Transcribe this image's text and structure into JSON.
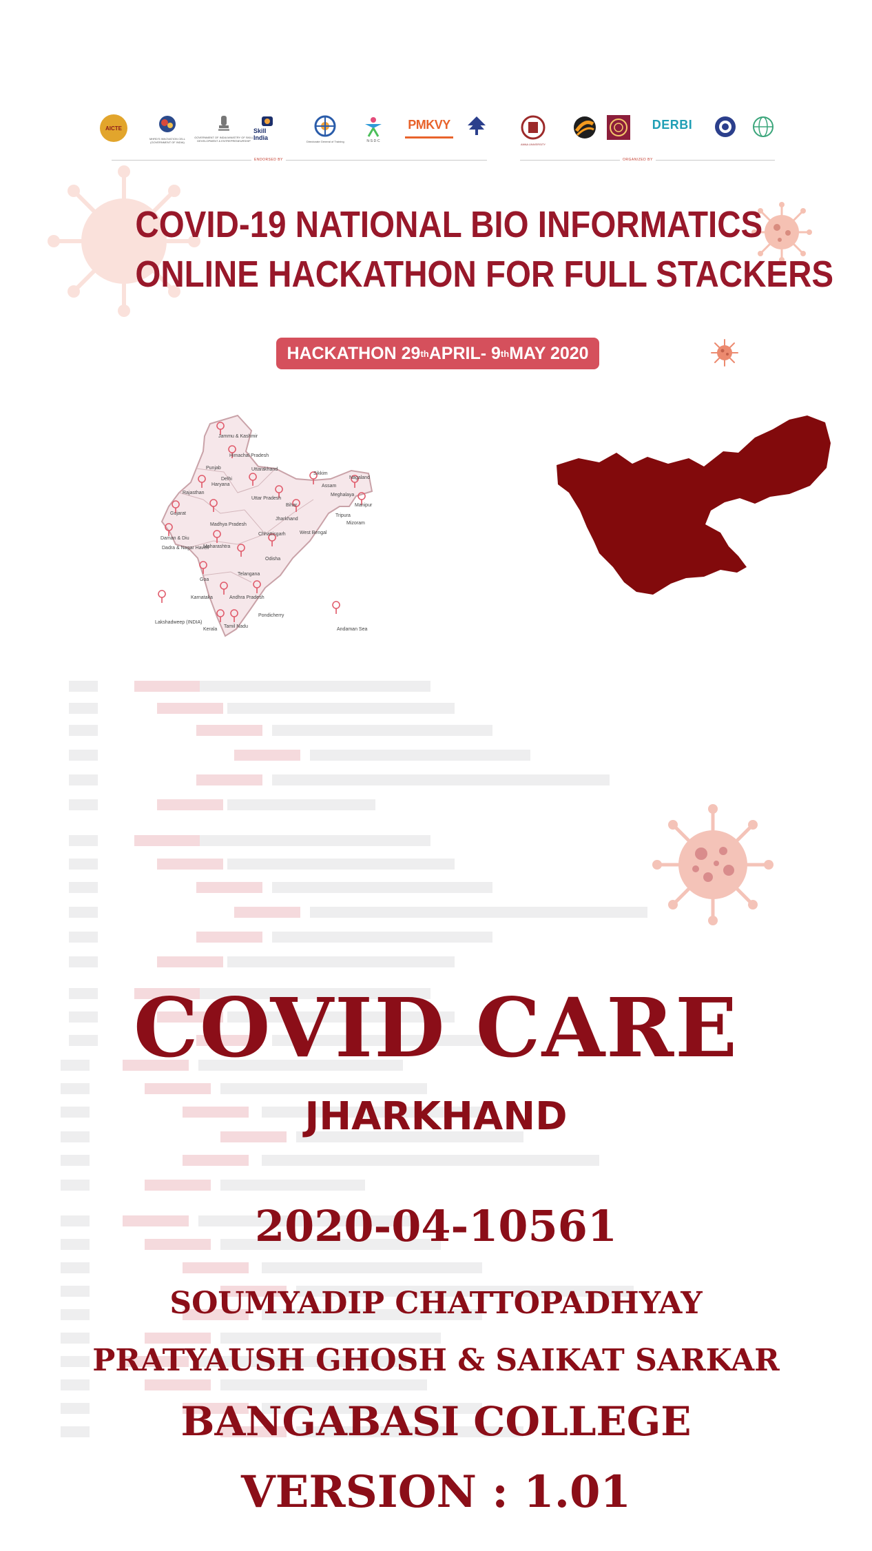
{
  "endorsed_by_label": "ENDORSED BY",
  "organized_by_label": "ORGANIZED BY",
  "endorsed_logos": [
    {
      "name": "aicte-logo",
      "caption": "",
      "text": "AICTE"
    },
    {
      "name": "innovation-cell-logo",
      "caption": "MHRD'S INNOVATION CELL (GOVERNMENT OF INDIA)",
      "text": ""
    },
    {
      "name": "msde-logo",
      "caption": "GOVERNMENT OF INDIA MINISTRY OF SKILL DEVELOPMENT & ENTREPRENEURSHIP",
      "text": ""
    },
    {
      "name": "skill-india-logo",
      "caption": "",
      "text": "Skill India"
    },
    {
      "name": "dgt-logo",
      "caption": "Directorate General of Training",
      "text": ""
    },
    {
      "name": "nsdc-logo",
      "caption": "N·S·D·C",
      "text": ""
    },
    {
      "name": "pmkvy-logo",
      "caption": "",
      "text": "PMKVY"
    },
    {
      "name": "emblem-logo",
      "caption": "",
      "text": ""
    }
  ],
  "organizer_logos": [
    {
      "name": "anna-university-logo",
      "caption": "ANNA UNIVERSITY",
      "text": ""
    },
    {
      "name": "organizer-logo-2",
      "caption": "",
      "text": ""
    },
    {
      "name": "organizer-logo-3",
      "caption": "",
      "text": ""
    },
    {
      "name": "derbi-logo",
      "caption": "",
      "text": "DERBI"
    },
    {
      "name": "organizer-logo-5",
      "caption": "",
      "text": ""
    },
    {
      "name": "organizer-logo-6",
      "caption": "",
      "text": ""
    }
  ],
  "event_title_line1": "COVID-19 NATIONAL BIO INFORMATICS",
  "event_title_line2": "ONLINE HACKATHON FOR FULL STACKERS",
  "date_pill": {
    "prefix": "HACKATHON  29",
    "sup1": "th",
    "middle": " APRIL- 9",
    "sup2": "th",
    "suffix": " MAY 2020"
  },
  "india_map_labels": [
    "Jammu & Kashmir",
    "Himachal Pradesh",
    "Punjab",
    "Uttarakhand",
    "Delhi",
    "Haryana",
    "Rajasthan",
    "Uttar Pradesh",
    "Sikkim",
    "Assam",
    "Nagaland",
    "Meghalaya",
    "Manipur",
    "Tripura",
    "Mizoram",
    "Bihar",
    "West Bengal",
    "Jharkhand",
    "Gujarat",
    "Madhya Pradesh",
    "Chhattisgarh",
    "Odisha",
    "Daman & Diu",
    "Dadra & Nagar Haveli",
    "Maharashtra",
    "Telangana",
    "Goa",
    "Karnataka",
    "Andhra Pradesh",
    "Lakshadweep (INDIA)",
    "Pondicherry",
    "Tamil Nadu",
    "Kerala",
    "Andaman Sea"
  ],
  "colors": {
    "title_red": "#98182a",
    "text_red": "#8b0e18",
    "pill_red": "#d5505c",
    "state_fill": "#820a0c",
    "virus_pink": "#f4c3b8"
  },
  "app_name": "COVID CARE",
  "region": "JHARKHAND",
  "submission_id": "2020-04-10561",
  "author_line1": "SOUMYADIP CHATTOPADHYAY",
  "author_line2": "PRATYAUSH GHOSH & SAIKAT SARKAR",
  "college": "BANGABASI COLLEGE",
  "version": "VERSION : 1.01"
}
